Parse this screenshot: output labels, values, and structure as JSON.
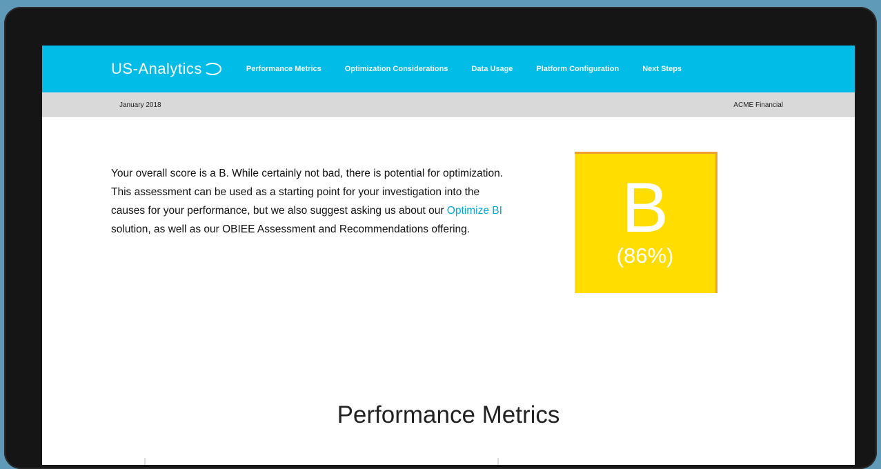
{
  "nav": {
    "logo_text": "US-Analytics",
    "links": [
      "Performance Metrics",
      "Optimization Considerations",
      "Data Usage",
      "Platform Configuration",
      "Next Steps"
    ]
  },
  "subbar": {
    "date": "January 2018",
    "client": "ACME Financial"
  },
  "summary": {
    "before_link": "Your overall score is a B. While certainly not bad, there is potential for optimization. This assessment can be used as a starting point for your investigation into the causes for your performance, but we also suggest asking us about our ",
    "link": "Optimize BI",
    "after_link": " solution, as well as our OBIEE Assessment and Recommendations offering."
  },
  "grade": {
    "letter": "B",
    "percent": "(86%)",
    "color": "#ffdd00",
    "border_color": "#f0a030"
  },
  "section": {
    "title": "Performance Metrics"
  },
  "colors": {
    "nav_bg": "#00bce6",
    "subbar_bg": "#d9d9d9",
    "link": "#00a9d6"
  }
}
